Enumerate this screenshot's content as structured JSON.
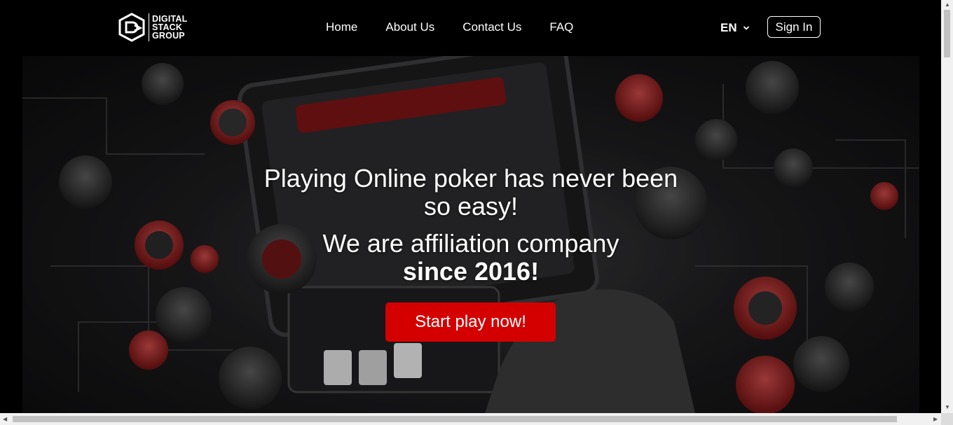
{
  "logo": {
    "line1": "DIGITAL",
    "line2": "STACK",
    "line3": "GROUP"
  },
  "nav": [
    {
      "label": "Home"
    },
    {
      "label": "About Us"
    },
    {
      "label": "Contact Us"
    },
    {
      "label": "FAQ"
    }
  ],
  "language": {
    "selected": "EN",
    "icon": "chevron-down-icon"
  },
  "signin": {
    "label": "Sign In"
  },
  "hero": {
    "headline": "Playing Online poker has never been so easy!",
    "sub_line1": "We are affiliation company",
    "sub_line2": "since 2016!",
    "cta_label": "Start play now!"
  },
  "colors": {
    "accent": "#d40000",
    "background": "#000000"
  }
}
